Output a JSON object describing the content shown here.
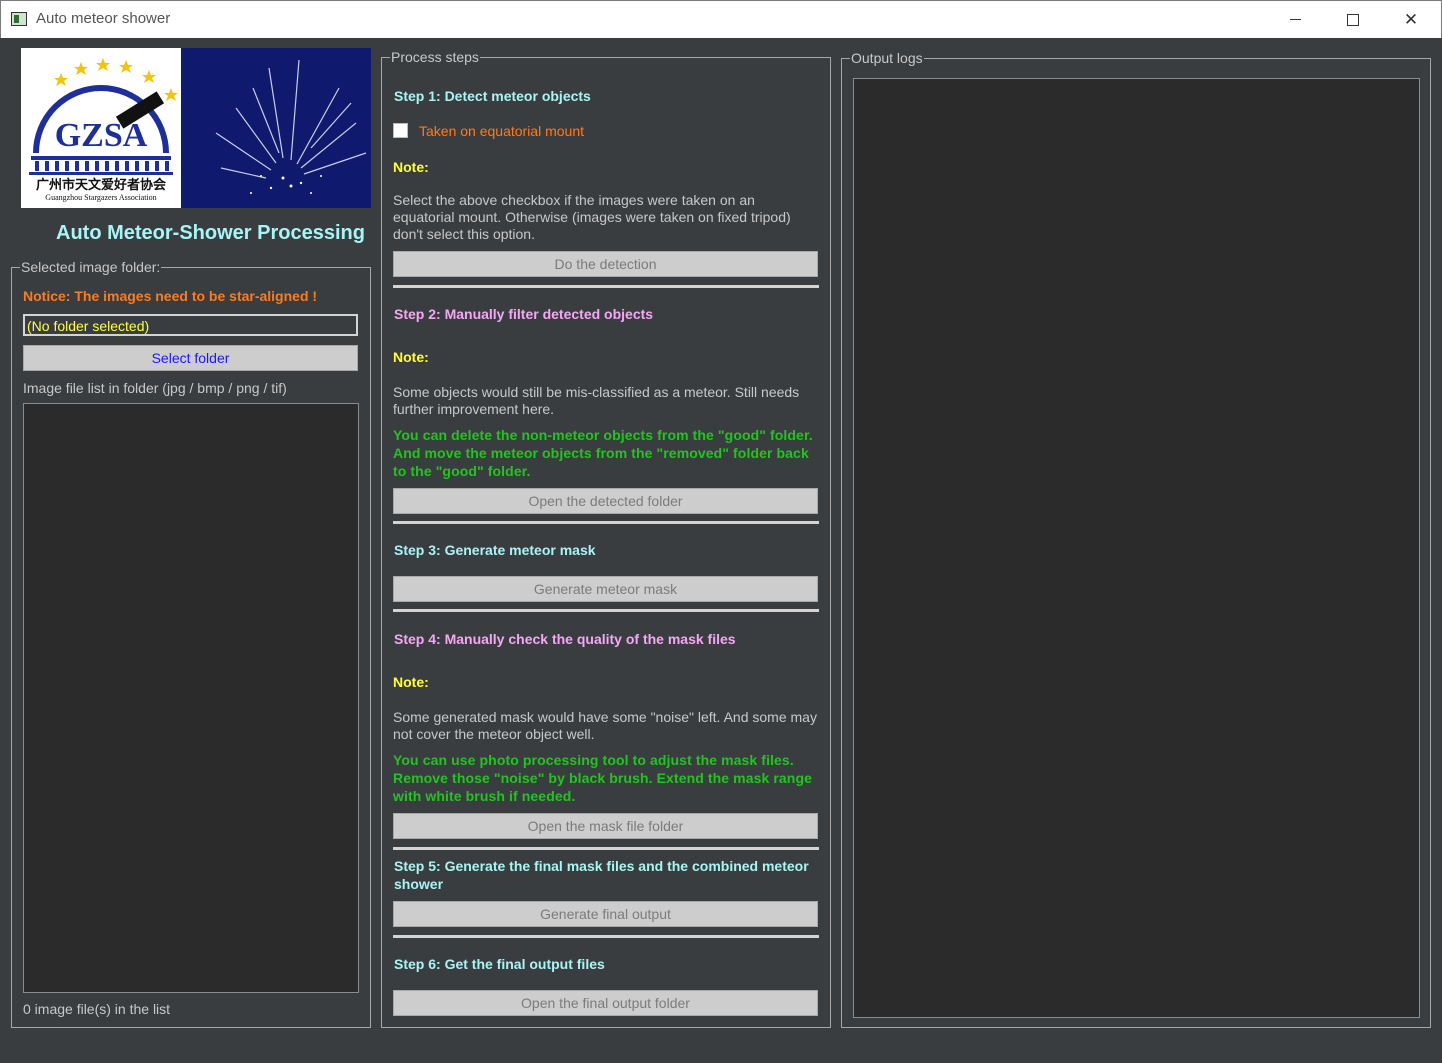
{
  "window": {
    "title": "Auto meteor shower",
    "minimize_icon": "minimize-icon",
    "maximize_icon": "maximize-icon",
    "close_icon": "close-icon",
    "close_glyph": "✕"
  },
  "logo": {
    "org_chinese": "广州市天文爱好者协会",
    "org_english": "Guangzhou Stargazers Association",
    "mark": "GZSA"
  },
  "left": {
    "heading": "Auto Meteor-Shower Processing",
    "group_label": "Selected image folder:",
    "notice": "Notice: The images need to be star-aligned !",
    "folder_value": "(No folder selected)",
    "select_button": "Select folder",
    "list_label": "Image file list in folder (jpg / bmp / png / tif)",
    "count_text": "0 image file(s) in the list"
  },
  "middle": {
    "group_label": "Process steps",
    "step1": {
      "title": "Step 1: Detect meteor objects",
      "checkbox_label": "Taken on equatorial mount",
      "checkbox_checked": false,
      "note": "Note:",
      "desc": "Select the above checkbox if the images were taken on an equatorial mount. Otherwise (images were taken on fixed tripod) don't select this option.",
      "button": "Do the detection"
    },
    "step2": {
      "title": "Step 2: Manually filter detected objects",
      "note": "Note:",
      "desc": "Some objects would still be mis-classified as a meteor. Still needs further improvement here.",
      "green": "You can delete the non-meteor objects from the \"good\" folder. And move the meteor objects from the \"removed\" folder back to the \"good\" folder.",
      "button": "Open the detected folder"
    },
    "step3": {
      "title": "Step 3: Generate meteor mask",
      "button": "Generate meteor mask"
    },
    "step4": {
      "title": "Step 4: Manually check the quality of the mask files",
      "note": "Note:",
      "desc": "Some generated mask would have some \"noise\" left. And some may not cover the meteor object well.",
      "green": "You can use photo processing tool to adjust the mask files. Remove those \"noise\" by black brush. Extend the mask range with white brush if needed.",
      "button": "Open the mask file folder"
    },
    "step5": {
      "title": "Step 5: Generate the final mask files and the combined meteor shower",
      "button": "Generate final output"
    },
    "step6": {
      "title": "Step 6: Get the final output files",
      "button": "Open the final output folder"
    }
  },
  "right": {
    "group_label": "Output logs"
  },
  "colors": {
    "background": "#3a3d40",
    "cyan_title": "#a7f5f5",
    "pink_title": "#f5a7f5",
    "note_yellow": "#ffff33",
    "notice_orange": "#ff7a1c",
    "tip_green": "#22c41f",
    "button_gray": "#cdcdcd",
    "logo_navy": "#0f1a6e"
  }
}
